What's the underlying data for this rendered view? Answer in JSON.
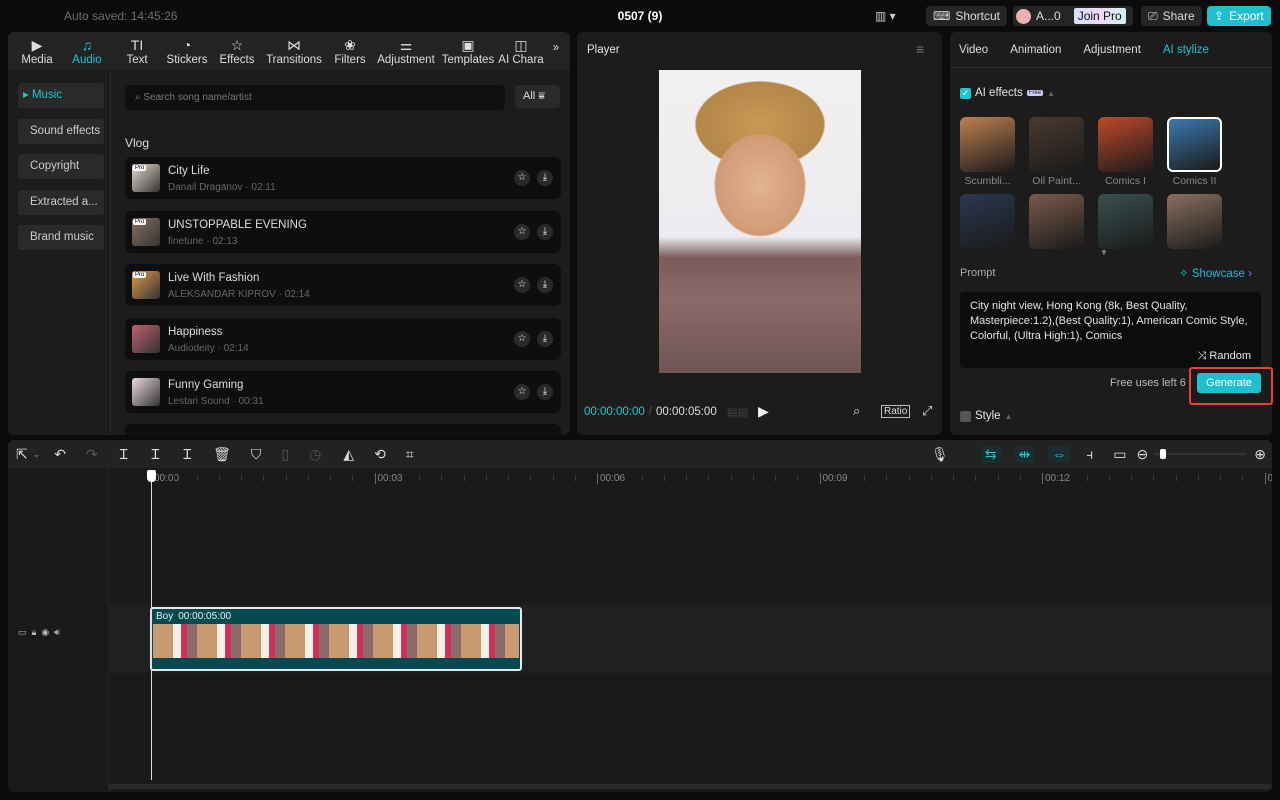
{
  "topbar": {
    "autosave": "Auto saved: 14:45:26",
    "title": "0507 (9)",
    "shortcut": "Shortcut",
    "user": "A...0",
    "join_pro": "Join Pro",
    "share": "Share",
    "export": "Export"
  },
  "left_tabs": [
    {
      "label": "Media",
      "icon": "▶"
    },
    {
      "label": "Audio",
      "icon": "♫"
    },
    {
      "label": "Text",
      "icon": "TI"
    },
    {
      "label": "Stickers",
      "icon": "◔"
    },
    {
      "label": "Effects",
      "icon": "☆"
    },
    {
      "label": "Transitions",
      "icon": "⋈"
    },
    {
      "label": "Filters",
      "icon": "❀"
    },
    {
      "label": "Adjustment",
      "icon": "⚌"
    },
    {
      "label": "Templates",
      "icon": "▣"
    },
    {
      "label": "AI Chara",
      "icon": "◫"
    }
  ],
  "categories": [
    "Music",
    "Sound effects",
    "Copyright",
    "Extracted a...",
    "Brand music"
  ],
  "search": {
    "placeholder": "Search song name/artist",
    "filter": "All"
  },
  "section": "Vlog",
  "songs": [
    {
      "title": "City Life",
      "artist": "Danail Draganov",
      "duration": "02:11",
      "pro": true,
      "color": "#e8ddd0"
    },
    {
      "title": "UNSTOPPABLE EVENING",
      "artist": "finetune",
      "duration": "02:13",
      "pro": true,
      "color": "#8a7060"
    },
    {
      "title": "Live With Fashion",
      "artist": "ALEKSANDAR KIPROV",
      "duration": "02:14",
      "pro": true,
      "color": "#e49a4c"
    },
    {
      "title": "Happiness",
      "artist": "Audiodeity",
      "duration": "02:14",
      "pro": false,
      "color": "#c06070"
    },
    {
      "title": "Funny Gaming",
      "artist": "Lestari Sound",
      "duration": "00:31",
      "pro": false,
      "color": "#e8d8dc"
    }
  ],
  "pro_label": "Pro",
  "player": {
    "title": "Player",
    "current": "00:00:00:00",
    "total": "00:00:05:00",
    "ratio": "Ratio"
  },
  "right": {
    "tabs": [
      "Video",
      "Animation",
      "Adjustment",
      "AI stylize"
    ],
    "active_tab": "AI stylize",
    "ai_effects": "AI effects",
    "free_badge": "Free",
    "styles": [
      {
        "name": "Scumbli...",
        "color": "#c08050"
      },
      {
        "name": "Oil Paint...",
        "color": "#4a3a30"
      },
      {
        "name": "Comics I",
        "color": "#c04a2a"
      },
      {
        "name": "Comics II",
        "color": "#3a7ab0"
      },
      {
        "name": "",
        "color": "#2a3850"
      },
      {
        "name": "",
        "color": "#7a5a4a"
      },
      {
        "name": "",
        "color": "#3a5050"
      },
      {
        "name": "",
        "color": "#8a7060"
      }
    ],
    "prompt_label": "Prompt",
    "showcase": "Showcase",
    "prompt": "City night view, Hong Kong (8k, Best Quality, Masterpiece:1.2),(Best Quality:1), American Comic Style, Colorful, (Ultra High:1), Comics",
    "random": "Random",
    "free_uses": "Free uses left 6",
    "generate": "Generate",
    "style": "Style"
  },
  "timeline": {
    "ticks": [
      "00:00",
      "00:03",
      "00:06",
      "00:09",
      "00:12",
      "00"
    ],
    "clip_name": "Boy",
    "clip_duration": "00:00:05:00"
  },
  "colors": {
    "accent": "#22c4d4",
    "highlight": "#e8403a"
  }
}
